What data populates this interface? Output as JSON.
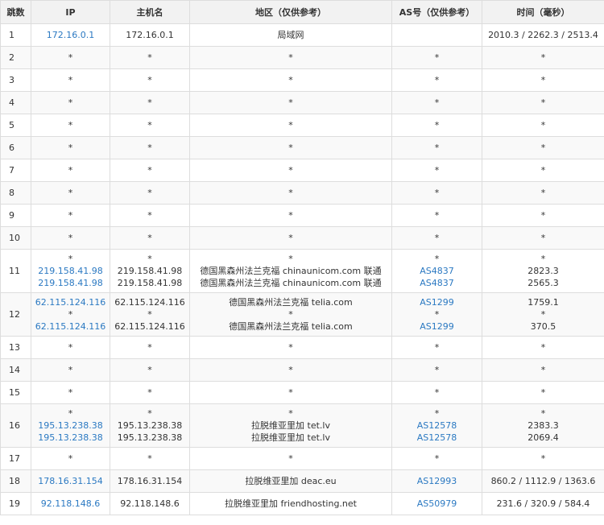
{
  "headers": {
    "hop": "跳数",
    "ip": "IP",
    "hostname": "主机名",
    "region": "地区（仅供参考）",
    "asn": "AS号（仅供参考）",
    "time": "时间（毫秒）"
  },
  "rows": [
    {
      "hop": "1",
      "lines": [
        {
          "ip": "172.16.0.1",
          "host": "172.16.0.1",
          "region": "局域网",
          "as": "",
          "time": "2010.3 / 2262.3 / 2513.4"
        }
      ]
    },
    {
      "hop": "2",
      "lines": [
        {
          "ip": "*",
          "host": "*",
          "region": "*",
          "as": "*",
          "time": "*"
        }
      ]
    },
    {
      "hop": "3",
      "lines": [
        {
          "ip": "*",
          "host": "*",
          "region": "*",
          "as": "*",
          "time": "*"
        }
      ]
    },
    {
      "hop": "4",
      "lines": [
        {
          "ip": "*",
          "host": "*",
          "region": "*",
          "as": "*",
          "time": "*"
        }
      ]
    },
    {
      "hop": "5",
      "lines": [
        {
          "ip": "*",
          "host": "*",
          "region": "*",
          "as": "*",
          "time": "*"
        }
      ]
    },
    {
      "hop": "6",
      "lines": [
        {
          "ip": "*",
          "host": "*",
          "region": "*",
          "as": "*",
          "time": "*"
        }
      ]
    },
    {
      "hop": "7",
      "lines": [
        {
          "ip": "*",
          "host": "*",
          "region": "*",
          "as": "*",
          "time": "*"
        }
      ]
    },
    {
      "hop": "8",
      "lines": [
        {
          "ip": "*",
          "host": "*",
          "region": "*",
          "as": "*",
          "time": "*"
        }
      ]
    },
    {
      "hop": "9",
      "lines": [
        {
          "ip": "*",
          "host": "*",
          "region": "*",
          "as": "*",
          "time": "*"
        }
      ]
    },
    {
      "hop": "10",
      "lines": [
        {
          "ip": "*",
          "host": "*",
          "region": "*",
          "as": "*",
          "time": "*"
        }
      ]
    },
    {
      "hop": "11",
      "lines": [
        {
          "ip": "*",
          "host": "*",
          "region": "*",
          "as": "*",
          "time": "*"
        },
        {
          "ip": "219.158.41.98",
          "host": "219.158.41.98",
          "region": "德国黑森州法兰克福 chinaunicom.com 联通",
          "as": "AS4837",
          "time": "2823.3"
        },
        {
          "ip": "219.158.41.98",
          "host": "219.158.41.98",
          "region": "德国黑森州法兰克福 chinaunicom.com 联通",
          "as": "AS4837",
          "time": "2565.3"
        }
      ]
    },
    {
      "hop": "12",
      "lines": [
        {
          "ip": "62.115.124.116",
          "host": "62.115.124.116",
          "region": "德国黑森州法兰克福 telia.com",
          "as": "AS1299",
          "time": "1759.1"
        },
        {
          "ip": "*",
          "host": "*",
          "region": "*",
          "as": "*",
          "time": "*"
        },
        {
          "ip": "62.115.124.116",
          "host": "62.115.124.116",
          "region": "德国黑森州法兰克福 telia.com",
          "as": "AS1299",
          "time": "370.5"
        }
      ]
    },
    {
      "hop": "13",
      "lines": [
        {
          "ip": "*",
          "host": "*",
          "region": "*",
          "as": "*",
          "time": "*"
        }
      ]
    },
    {
      "hop": "14",
      "lines": [
        {
          "ip": "*",
          "host": "*",
          "region": "*",
          "as": "*",
          "time": "*"
        }
      ]
    },
    {
      "hop": "15",
      "lines": [
        {
          "ip": "*",
          "host": "*",
          "region": "*",
          "as": "*",
          "time": "*"
        }
      ]
    },
    {
      "hop": "16",
      "lines": [
        {
          "ip": "*",
          "host": "*",
          "region": "*",
          "as": "*",
          "time": "*"
        },
        {
          "ip": "195.13.238.38",
          "host": "195.13.238.38",
          "region": "拉脱维亚里加 tet.lv",
          "as": "AS12578",
          "time": "2383.3"
        },
        {
          "ip": "195.13.238.38",
          "host": "195.13.238.38",
          "region": "拉脱维亚里加 tet.lv",
          "as": "AS12578",
          "time": "2069.4"
        }
      ]
    },
    {
      "hop": "17",
      "lines": [
        {
          "ip": "*",
          "host": "*",
          "region": "*",
          "as": "*",
          "time": "*"
        }
      ]
    },
    {
      "hop": "18",
      "lines": [
        {
          "ip": "178.16.31.154",
          "host": "178.16.31.154",
          "region": "拉脱维亚里加 deac.eu",
          "as": "AS12993",
          "time": "860.2 / 1112.9 / 1363.6"
        }
      ]
    },
    {
      "hop": "19",
      "lines": [
        {
          "ip": "92.118.148.6",
          "host": "92.118.148.6",
          "region": "拉脱维亚里加 friendhosting.net",
          "as": "AS50979",
          "time": "231.6 / 320.9 / 584.4"
        }
      ]
    }
  ],
  "colors": {
    "link": "#2b79c2",
    "border": "#dddddd",
    "header_bg": "#f2f2f2",
    "zebra_bg": "#f9f9f9"
  }
}
